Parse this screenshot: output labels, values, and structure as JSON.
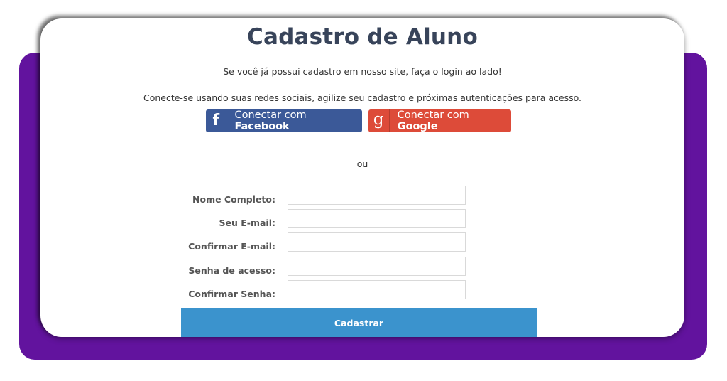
{
  "page": {
    "title": "Cadastro de Aluno",
    "login_hint": "Se você já possui cadastro em nosso site, faça o login ao lado!",
    "social_hint": "Conecte-se usando suas redes sociais, agilize seu cadastro e próximas autenticações para acesso.",
    "or_text": "ou"
  },
  "social": {
    "facebook": {
      "icon": "facebook-icon",
      "prefix": "Conectar com ",
      "brand": "Facebook",
      "color": "#3b5998"
    },
    "google": {
      "icon": "google-icon",
      "prefix": "Conectar com ",
      "brand": "Google",
      "color": "#dd4b39"
    }
  },
  "form": {
    "fields": [
      {
        "label": "Nome Completo:",
        "value": ""
      },
      {
        "label": "Seu E-mail:",
        "value": ""
      },
      {
        "label": "Confirmar E-mail:",
        "value": ""
      },
      {
        "label": "Senha de acesso:",
        "value": ""
      },
      {
        "label": "Confirmar Senha:",
        "value": ""
      }
    ],
    "submit_label": "Cadastrar",
    "submit_color": "#3b93cd"
  },
  "colors": {
    "backdrop": "#62139e",
    "title": "#38445a"
  }
}
